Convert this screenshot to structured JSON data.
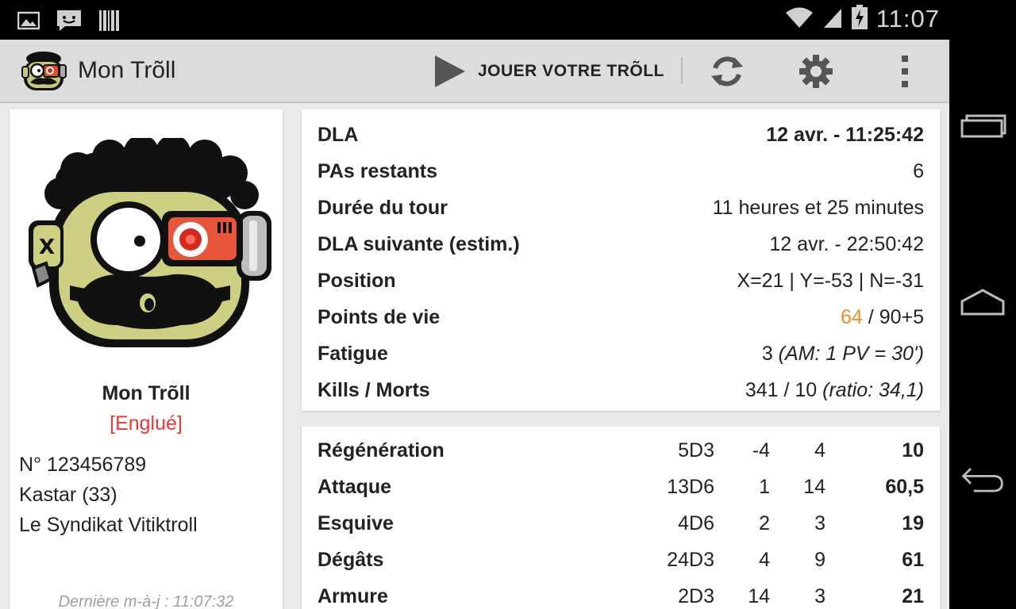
{
  "status_bar": {
    "time": "11:07",
    "icons": [
      "gallery-icon",
      "chat-icon",
      "barcode-icon",
      "wifi-icon",
      "signal-icon",
      "battery-charging-icon"
    ]
  },
  "action_bar": {
    "title": "Mon Trõll",
    "play_label": "JOUER VOTRE TRÕLL",
    "icons": [
      "refresh-icon",
      "settings-gear-icon",
      "overflow-menu-icon"
    ]
  },
  "profile": {
    "name": "Mon Trõll",
    "status": "[Englué]",
    "number": "N° 123456789",
    "race": "Kastar (33)",
    "guild": "Le Syndikat Vitiktroll",
    "last_update": "Dernière m-à-j : 11:07:32"
  },
  "details": {
    "dla": {
      "label": "DLA",
      "value": "12 avr. - 11:25:42"
    },
    "pa": {
      "label": "PAs restants",
      "value": "6"
    },
    "duree": {
      "label": "Durée du tour",
      "value": "11 heures et 25 minutes"
    },
    "dla_next": {
      "label": "DLA suivante (estim.)",
      "value": "12 avr. - 22:50:42"
    },
    "position": {
      "label": "Position",
      "value": "X=21 | Y=-53 | N=-31"
    },
    "pv": {
      "label": "Points de vie",
      "current": "64",
      "max": "/ 90+5"
    },
    "fatigue": {
      "label": "Fatigue",
      "value": "3",
      "note": "(AM: 1 PV = 30')"
    },
    "kills": {
      "label": "Kills / Morts",
      "value": "341 / 10",
      "note": "(ratio: 34,1)"
    }
  },
  "stats": [
    {
      "label": "Régénération",
      "dice": "5D3",
      "bm1": "-4",
      "bm2": "4",
      "total": "10"
    },
    {
      "label": "Attaque",
      "dice": "13D6",
      "bm1": "1",
      "bm2": "14",
      "total": "60,5"
    },
    {
      "label": "Esquive",
      "dice": "4D6",
      "bm1": "2",
      "bm2": "3",
      "total": "19"
    },
    {
      "label": "Dégâts",
      "dice": "24D3",
      "bm1": "4",
      "bm2": "9",
      "total": "61"
    },
    {
      "label": "Armure",
      "dice": "2D3",
      "bm1": "14",
      "bm2": "3",
      "total": "21"
    }
  ],
  "colors": {
    "accent_orange": "#f08a24",
    "status_red": "#e53935"
  }
}
